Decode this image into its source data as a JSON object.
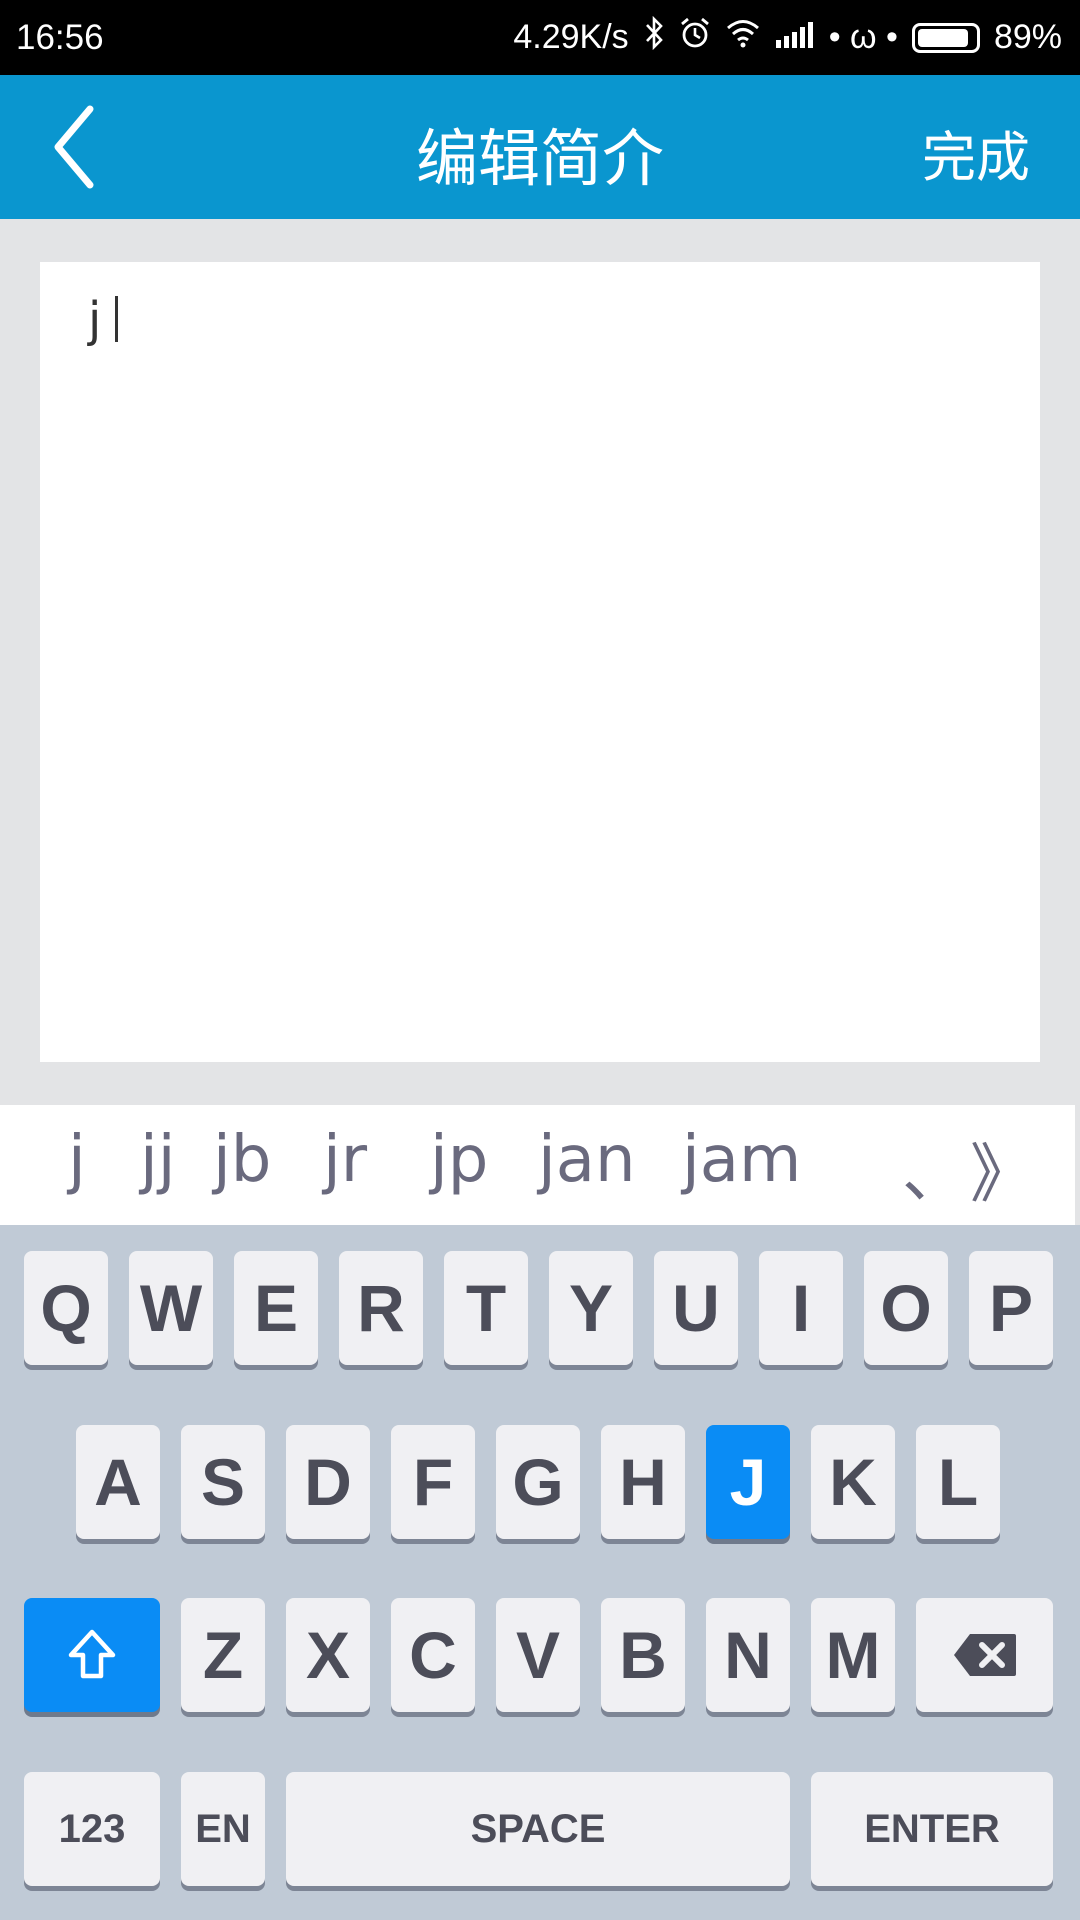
{
  "status_bar": {
    "time": "16:56",
    "net_speed": "4.29K/s",
    "bluetooth_icon": "bluetooth-icon",
    "alarm_icon": "alarm-icon",
    "wifi_icon": "wifi-icon",
    "signal_icon": "signal-icon",
    "extra": "• ω •",
    "battery": "89%",
    "battery_level": 0.89
  },
  "header": {
    "back_icon": "chevron-left-icon",
    "title": "编辑简介",
    "done_label": "完成",
    "bg_color": "#0a96cf"
  },
  "editor": {
    "value": "j"
  },
  "candidates": {
    "items": [
      "j",
      "jj",
      "jb",
      "jr",
      "jp",
      "jan",
      "jam"
    ],
    "punct": "、",
    "more": "》"
  },
  "keyboard": {
    "row1": [
      "Q",
      "W",
      "E",
      "R",
      "T",
      "Y",
      "U",
      "I",
      "O",
      "P"
    ],
    "row2": [
      "A",
      "S",
      "D",
      "F",
      "G",
      "H",
      "J",
      "K",
      "L"
    ],
    "row3": [
      "Z",
      "X",
      "C",
      "V",
      "B",
      "N",
      "M"
    ],
    "highlighted_key": "J",
    "shift_icon": "shift-arrow-icon",
    "backspace_icon": "backspace-icon",
    "num_label": "123",
    "lang_label": "EN",
    "space_label": "SPACE",
    "enter_label": "ENTER",
    "accent_color": "#0a8cf5"
  }
}
